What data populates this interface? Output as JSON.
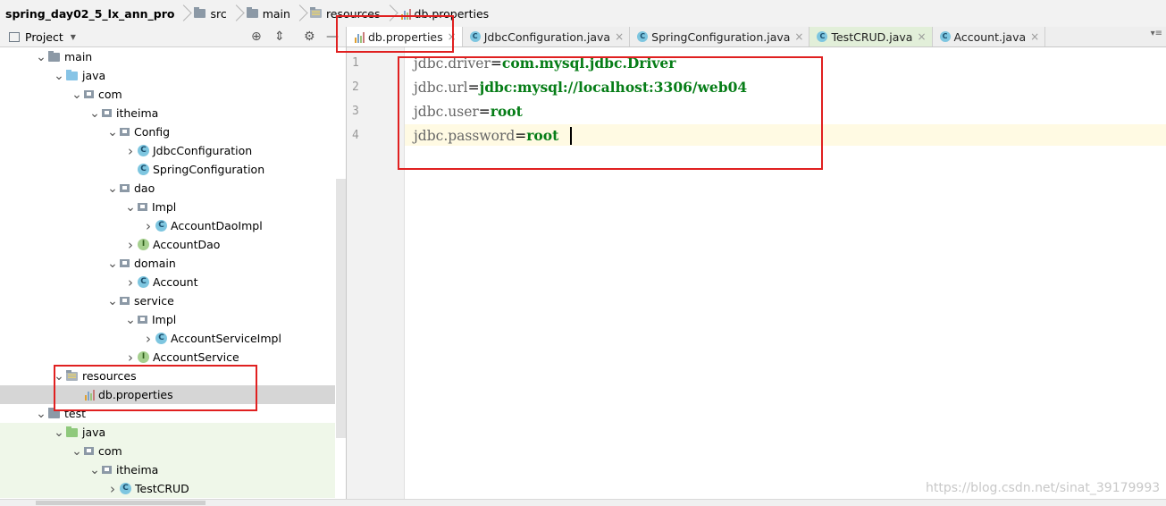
{
  "breadcrumb": [
    "spring_day02_5_lx_ann_pro",
    "src",
    "main",
    "resources",
    "db.properties"
  ],
  "project_panel": {
    "title": "Project"
  },
  "tree": [
    {
      "label": "main",
      "kind": "folder",
      "arrow": "down"
    },
    {
      "label": "java",
      "kind": "java-folder",
      "arrow": "down"
    },
    {
      "label": "com",
      "kind": "package",
      "arrow": "down"
    },
    {
      "label": "itheima",
      "kind": "package",
      "arrow": "down"
    },
    {
      "label": "Config",
      "kind": "package",
      "arrow": "down"
    },
    {
      "label": "JdbcConfiguration",
      "kind": "class",
      "arrow": "right"
    },
    {
      "label": "SpringConfiguration",
      "kind": "class",
      "arrow": ""
    },
    {
      "label": "dao",
      "kind": "package",
      "arrow": "down"
    },
    {
      "label": "Impl",
      "kind": "package",
      "arrow": "down"
    },
    {
      "label": "AccountDaoImpl",
      "kind": "class",
      "arrow": "right"
    },
    {
      "label": "AccountDao",
      "kind": "interface",
      "arrow": "right"
    },
    {
      "label": "domain",
      "kind": "package",
      "arrow": "down"
    },
    {
      "label": "Account",
      "kind": "class",
      "arrow": "right"
    },
    {
      "label": "service",
      "kind": "package",
      "arrow": "down"
    },
    {
      "label": "Impl",
      "kind": "package",
      "arrow": "down"
    },
    {
      "label": "AccountServiceImpl",
      "kind": "class",
      "arrow": "right"
    },
    {
      "label": "AccountService",
      "kind": "interface",
      "arrow": "right"
    },
    {
      "label": "resources",
      "kind": "res-folder",
      "arrow": "down"
    },
    {
      "label": "db.properties",
      "kind": "properties",
      "arrow": ""
    },
    {
      "label": "test",
      "kind": "folder",
      "arrow": "down"
    },
    {
      "label": "java",
      "kind": "test-java-folder",
      "arrow": "down"
    },
    {
      "label": "com",
      "kind": "package",
      "arrow": "down"
    },
    {
      "label": "itheima",
      "kind": "package",
      "arrow": "down"
    },
    {
      "label": "TestCRUD",
      "kind": "test-class",
      "arrow": "right"
    }
  ],
  "tabs": [
    {
      "label": "db.properties",
      "icon": "properties-icon",
      "active": true
    },
    {
      "label": "JdbcConfiguration.java",
      "icon": "class-icon"
    },
    {
      "label": "SpringConfiguration.java",
      "icon": "class-icon"
    },
    {
      "label": "TestCRUD.java",
      "icon": "test-class-icon"
    },
    {
      "label": "Account.java",
      "icon": "class-icon"
    }
  ],
  "editor": {
    "line_numbers": [
      "1",
      "2",
      "3",
      "4"
    ],
    "lines": [
      {
        "key": "jdbc.driver",
        "eq": "=",
        "value": "com.mysql.jdbc.Driver"
      },
      {
        "key": "jdbc.url",
        "eq": "=",
        "value": "jdbc:mysql://localhost:3306/web04"
      },
      {
        "key": "jdbc.user",
        "eq": "=",
        "value": "root"
      },
      {
        "key": "jdbc.password",
        "eq": "=",
        "value": "root"
      }
    ]
  },
  "watermark": "https://blog.csdn.net/sinat_39179993",
  "colors": {
    "highlight": "#e02020",
    "value_green": "#067d17",
    "caret_line": "#fffae3"
  }
}
